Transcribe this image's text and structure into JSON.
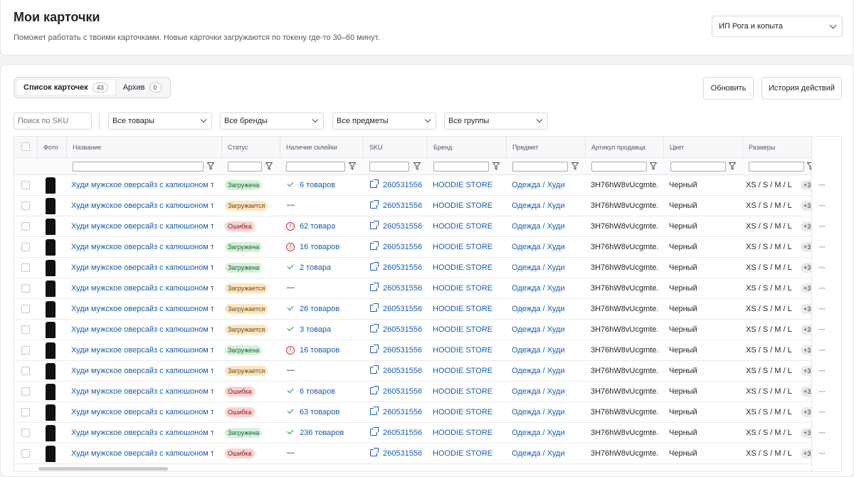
{
  "header": {
    "title": "Мои карточки",
    "subtitle": "Поможет работать с твоими карточками. Новые карточки загружаются по токену где-то 30–60 минут.",
    "account": "ИП Рога и копыта"
  },
  "tabs": [
    {
      "label": "Список карточек",
      "count": "43"
    },
    {
      "label": "Архив",
      "count": "0"
    }
  ],
  "actions": {
    "refresh": "Обновить",
    "history": "История действий"
  },
  "filters": {
    "search_placeholder": "Поиск по SKU",
    "products": "Все товары",
    "brands": "Все бренды",
    "subjects": "Все предметы",
    "groups": "Все группы"
  },
  "columns": {
    "photo": "Фото",
    "name": "Название",
    "status": "Статус",
    "glue": "Наличие склейки",
    "sku": "SKU",
    "brand": "Бренд",
    "subject": "Предмет",
    "vendor": "Артикул продавца",
    "color": "Цвет",
    "sizes": "Размеры"
  },
  "colors": {
    "link": "#1a5ea8",
    "ok": "#d4f1dc",
    "loading": "#fce6c2",
    "error": "#fbd2d2"
  },
  "rows": [
    {
      "name": "Худи мужское оверсайз с капюшоном т...",
      "status": "Загружена",
      "status_type": "ok",
      "glue_type": "check",
      "glue": "6 товаров",
      "sku": "260531556",
      "brand": "HOODIE STORE",
      "subject": "Одежда / Худи",
      "vendor": "3H76hW8vUcgmte...",
      "color": "Черный",
      "sizes": "XS / S / M / L",
      "more_sizes": "+3"
    },
    {
      "name": "Худи мужское оверсайз с капюшоном т...",
      "status": "Загружается",
      "status_type": "load",
      "glue_type": "none",
      "glue": "—",
      "sku": "260531556",
      "brand": "HOODIE STORE",
      "subject": "Одежда / Худи",
      "vendor": "3H76hW8vUcgmte...",
      "color": "Черный",
      "sizes": "XS / S / M / L",
      "more_sizes": "+3"
    },
    {
      "name": "Худи мужское оверсайз с капюшоном т...",
      "status": "Ошибка",
      "status_type": "err",
      "glue_type": "error",
      "glue": "62 товара",
      "sku": "260531556",
      "brand": "HOODIE STORE",
      "subject": "Одежда / Худи",
      "vendor": "3H76hW8vUcgmte...",
      "color": "Черный",
      "sizes": "XS / S / M / L",
      "more_sizes": "+3"
    },
    {
      "name": "Худи мужское оверсайз с капюшоном т...",
      "status": "Загружена",
      "status_type": "ok",
      "glue_type": "error",
      "glue": "16 товаров",
      "sku": "260531556",
      "brand": "HOODIE STORE",
      "subject": "Одежда / Худи",
      "vendor": "3H76hW8vUcgmte...",
      "color": "Черный",
      "sizes": "XS / S / M / L",
      "more_sizes": "+3"
    },
    {
      "name": "Худи мужское оверсайз с капюшоном т...",
      "status": "Загружена",
      "status_type": "ok",
      "glue_type": "check",
      "glue": "2 товара",
      "sku": "260531556",
      "brand": "HOODIE STORE",
      "subject": "Одежда / Худи",
      "vendor": "3H76hW8vUcgmte...",
      "color": "Черный",
      "sizes": "XS / S / M / L",
      "more_sizes": "+3"
    },
    {
      "name": "Худи мужское оверсайз с капюшоном т...",
      "status": "Загружается",
      "status_type": "load",
      "glue_type": "none",
      "glue": "—",
      "sku": "260531556",
      "brand": "HOODIE STORE",
      "subject": "Одежда / Худи",
      "vendor": "3H76hW8vUcgmte...",
      "color": "Черный",
      "sizes": "XS / S / M / L",
      "more_sizes": "+3"
    },
    {
      "name": "Худи мужское оверсайз с капюшоном т...",
      "status": "Загружается",
      "status_type": "load",
      "glue_type": "check",
      "glue": "26 товаров",
      "sku": "260531556",
      "brand": "HOODIE STORE",
      "subject": "Одежда / Худи",
      "vendor": "3H76hW8vUcgmte...",
      "color": "Черный",
      "sizes": "XS / S / M / L",
      "more_sizes": "+3"
    },
    {
      "name": "Худи мужское оверсайз с капюшоном т...",
      "status": "Загружается",
      "status_type": "load",
      "glue_type": "check",
      "glue": "3 товара",
      "sku": "260531556",
      "brand": "HOODIE STORE",
      "subject": "Одежда / Худи",
      "vendor": "3H76hW8vUcgmte...",
      "color": "Черный",
      "sizes": "XS / S / M / L",
      "more_sizes": "+3"
    },
    {
      "name": "Худи мужское оверсайз с капюшоном т...",
      "status": "Загружена",
      "status_type": "ok",
      "glue_type": "error",
      "glue": "16 товаров",
      "sku": "260531556",
      "brand": "HOODIE STORE",
      "subject": "Одежда / Худи",
      "vendor": "3H76hW8vUcgmte...",
      "color": "Черный",
      "sizes": "XS / S / M / L",
      "more_sizes": "+3"
    },
    {
      "name": "Худи мужское оверсайз с капюшоном т...",
      "status": "Загружается",
      "status_type": "load",
      "glue_type": "none",
      "glue": "—",
      "sku": "260531556",
      "brand": "HOODIE STORE",
      "subject": "Одежда / Худи",
      "vendor": "3H76hW8vUcgmte...",
      "color": "Черный",
      "sizes": "XS / S / M / L",
      "more_sizes": "+3"
    },
    {
      "name": "Худи мужское оверсайз с капюшоном т...",
      "status": "Ошибка",
      "status_type": "err",
      "glue_type": "check",
      "glue": "6 товаров",
      "sku": "260531556",
      "brand": "HOODIE STORE",
      "subject": "Одежда / Худи",
      "vendor": "3H76hW8vUcgmte...",
      "color": "Черный",
      "sizes": "XS / S / M / L",
      "more_sizes": "+3"
    },
    {
      "name": "Худи мужское оверсайз с капюшоном т...",
      "status": "Ошибка",
      "status_type": "err",
      "glue_type": "check",
      "glue": "63 товаров",
      "sku": "260531556",
      "brand": "HOODIE STORE",
      "subject": "Одежда / Худи",
      "vendor": "3H76hW8vUcgmte...",
      "color": "Черный",
      "sizes": "XS / S / M / L",
      "more_sizes": "+3"
    },
    {
      "name": "Худи мужское оверсайз с капюшоном т...",
      "status": "Загружена",
      "status_type": "ok",
      "glue_type": "check",
      "glue": "236 товаров",
      "sku": "260531556",
      "brand": "HOODIE STORE",
      "subject": "Одежда / Худи",
      "vendor": "3H76hW8vUcgmte...",
      "color": "Черный",
      "sizes": "XS / S / M / L",
      "more_sizes": "+3"
    },
    {
      "name": "Худи мужское оверсайз с капюшоном т...",
      "status": "Ошибка",
      "status_type": "err",
      "glue_type": "none",
      "glue": "—",
      "sku": "260531556",
      "brand": "HOODIE STORE",
      "subject": "Одежда / Худи",
      "vendor": "3H76hW8vUcgmte...",
      "color": "Черный",
      "sizes": "XS / S / M / L",
      "more_sizes": "+3"
    }
  ]
}
